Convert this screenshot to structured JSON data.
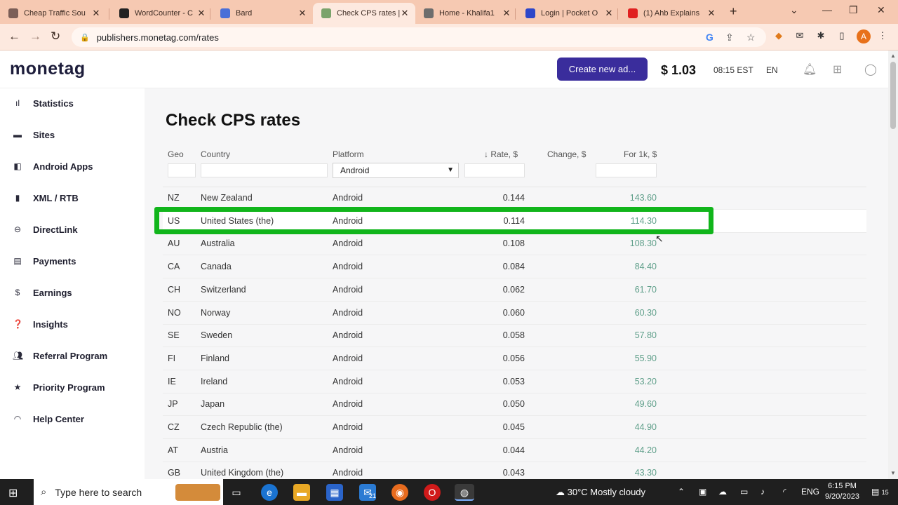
{
  "browser": {
    "tabs": [
      {
        "title": "Cheap Traffic Sou",
        "color": "#7b5e57"
      },
      {
        "title": "WordCounter - C",
        "color": "#222222"
      },
      {
        "title": "Bard",
        "color": "#4a6fd8"
      },
      {
        "title": "Check CPS rates |",
        "color": "#7aa36b"
      },
      {
        "title": "Home - Khalifa1",
        "color": "#6d6d6d"
      },
      {
        "title": "Login | Pocket O",
        "color": "#2d46c9"
      },
      {
        "title": "(1) Ahb Explains",
        "color": "#e02020"
      }
    ],
    "url": "publishers.monetag.com/rates",
    "profile_initial": "A"
  },
  "site": {
    "logo": "monetag",
    "create_button": "Create new ad...",
    "balance": "$ 1.03",
    "time": "08:15 EST",
    "language": "EN"
  },
  "sidebar": {
    "items": [
      {
        "label": "Statistics",
        "icon": "bar-chart-icon"
      },
      {
        "label": "Sites",
        "icon": "sites-icon"
      },
      {
        "label": "Android Apps",
        "icon": "android-icon"
      },
      {
        "label": "XML / RTB",
        "icon": "document-icon"
      },
      {
        "label": "DirectLink",
        "icon": "link-icon"
      },
      {
        "label": "Payments",
        "icon": "payments-icon"
      },
      {
        "label": "Earnings",
        "icon": "dollar-icon"
      },
      {
        "label": "Insights",
        "icon": "insights-icon"
      },
      {
        "label": "Referral Program",
        "icon": "users-icon"
      },
      {
        "label": "Priority Program",
        "icon": "star-icon"
      },
      {
        "label": "Help Center",
        "icon": "headset-icon"
      }
    ]
  },
  "page": {
    "title": "Check CPS rates",
    "columns": {
      "geo": "Geo",
      "country": "Country",
      "platform": "Platform",
      "rate": "↓ Rate, $",
      "change": "Change, $",
      "per_1k": "For 1k, $"
    },
    "platform_filter": "Android",
    "highlighted_row": 1,
    "rows": [
      {
        "geo": "NZ",
        "country": "New Zealand",
        "platform": "Android",
        "rate": "0.144",
        "per_1k": "143.60"
      },
      {
        "geo": "US",
        "country": "United States (the)",
        "platform": "Android",
        "rate": "0.114",
        "per_1k": "114.30"
      },
      {
        "geo": "AU",
        "country": "Australia",
        "platform": "Android",
        "rate": "0.108",
        "per_1k": "108.30"
      },
      {
        "geo": "CA",
        "country": "Canada",
        "platform": "Android",
        "rate": "0.084",
        "per_1k": "84.40"
      },
      {
        "geo": "CH",
        "country": "Switzerland",
        "platform": "Android",
        "rate": "0.062",
        "per_1k": "61.70"
      },
      {
        "geo": "NO",
        "country": "Norway",
        "platform": "Android",
        "rate": "0.060",
        "per_1k": "60.30"
      },
      {
        "geo": "SE",
        "country": "Sweden",
        "platform": "Android",
        "rate": "0.058",
        "per_1k": "57.80"
      },
      {
        "geo": "FI",
        "country": "Finland",
        "platform": "Android",
        "rate": "0.056",
        "per_1k": "55.90"
      },
      {
        "geo": "IE",
        "country": "Ireland",
        "platform": "Android",
        "rate": "0.053",
        "per_1k": "53.20"
      },
      {
        "geo": "JP",
        "country": "Japan",
        "platform": "Android",
        "rate": "0.050",
        "per_1k": "49.60"
      },
      {
        "geo": "CZ",
        "country": "Czech Republic (the)",
        "platform": "Android",
        "rate": "0.045",
        "per_1k": "44.90"
      },
      {
        "geo": "AT",
        "country": "Austria",
        "platform": "Android",
        "rate": "0.044",
        "per_1k": "44.20"
      },
      {
        "geo": "GB",
        "country": "United Kingdom (the)",
        "platform": "Android",
        "rate": "0.043",
        "per_1k": "43.30"
      }
    ]
  },
  "taskbar": {
    "search_placeholder": "Type here to search",
    "mail_badge": "21",
    "weather": "30°C  Mostly cloudy",
    "lang": "ENG",
    "time": "6:15 PM",
    "date": "9/20/2023",
    "notifications": "15"
  },
  "colors": {
    "accent": "#3a2d9c",
    "highlight": "#11b51b",
    "per_1k_text": "#5f9f8a"
  }
}
